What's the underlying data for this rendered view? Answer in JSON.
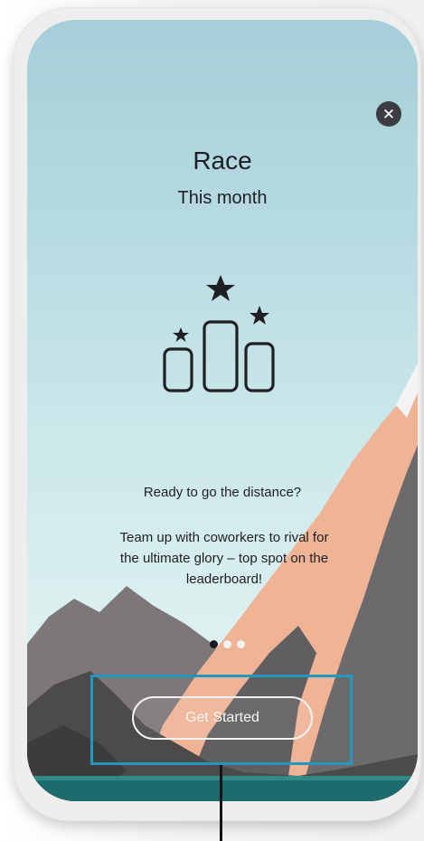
{
  "onboarding": {
    "close_icon": "close-icon",
    "close_glyph": "✕",
    "title": "Race",
    "subtitle": "This month",
    "illustration_icon": "podium-stars-icon",
    "tagline": "Ready to go the distance?",
    "description": "Team up with coworkers to rival for the ultimate glory – top spot on the leaderboard!",
    "pager": {
      "total": 3,
      "active": 1
    },
    "cta_label": "Get Started"
  },
  "colors": {
    "sky_top": "#a6cfd9",
    "mountain_dark": "#5a5758",
    "mountain_peach": "#f0b598",
    "lake": "#1e6b6e",
    "highlight_box": "#1f98c2"
  }
}
